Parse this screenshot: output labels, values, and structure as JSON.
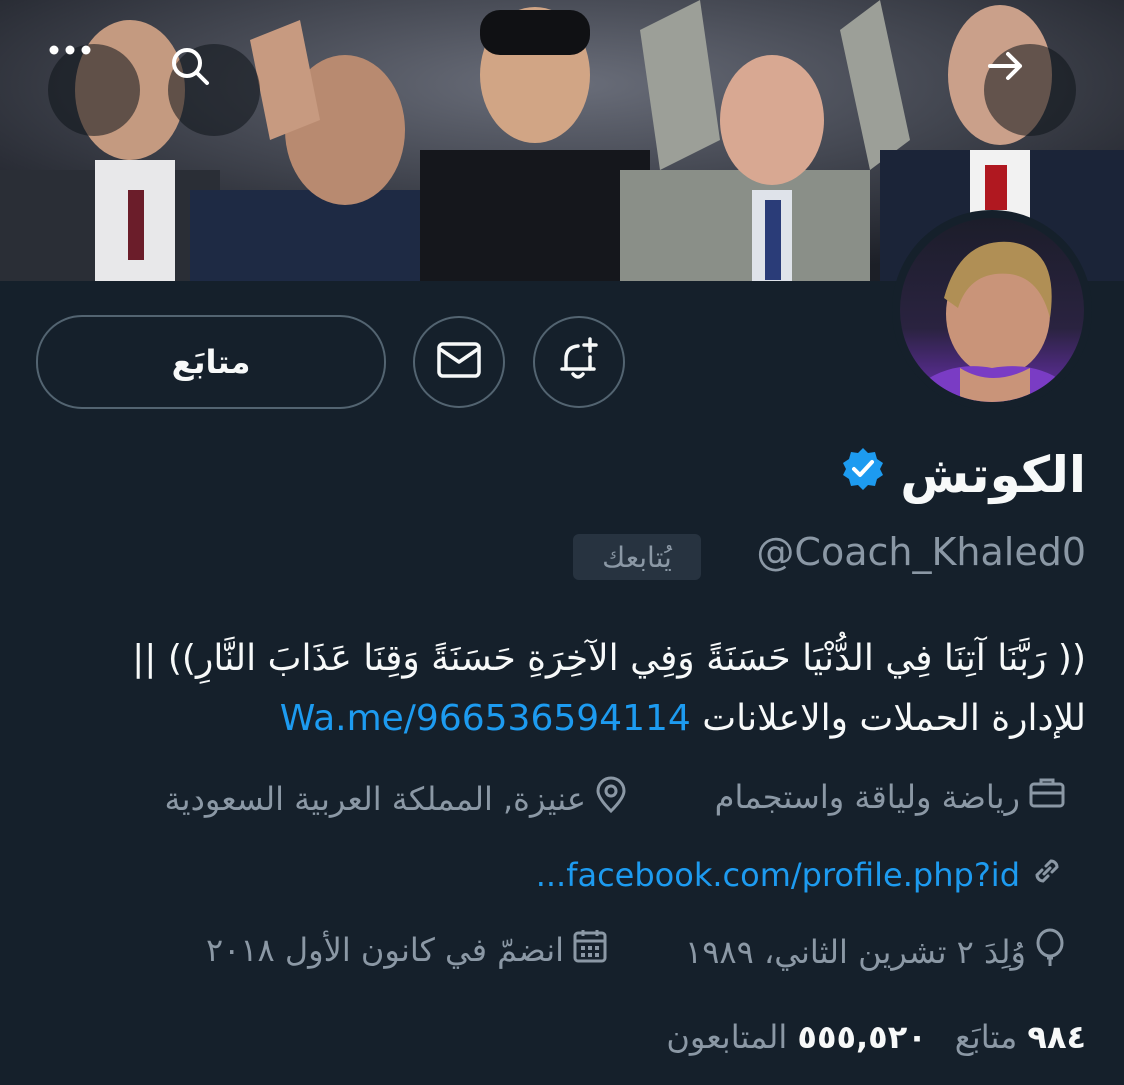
{
  "header": {
    "back_icon": "arrow-right-icon",
    "search_icon": "search-icon",
    "more_icon": "more-icon"
  },
  "actions": {
    "follow_label": "متابَع",
    "message_icon": "envelope-icon",
    "notify_icon": "bell-plus-icon"
  },
  "profile": {
    "name": "الكوتش",
    "verified_icon": "verified-badge-icon",
    "handle": "@Coach_Khaled0",
    "follows_you": "يُتابعك",
    "bio_line1": "(( رَبَّنَا آتِنَا فِي الدُّنْيَا حَسَنَةً وَفِي الآخِرَةِ حَسَنَةً وَقِنَا عَذَابَ النَّارِ)) ||",
    "bio_line2_text": "للإدارة الحملات والاعلانات",
    "bio_link": "Wa.me/966536594114",
    "category": "رياضة ولياقة واستجمام",
    "location": "عنيزة, المملكة العربية السعودية",
    "website": "facebook.com/profile.php?id...",
    "born": "وُلِدَ ٢ تشرين الثاني، ١٩٨٩",
    "joined": "انضمّ في كانون الأول ٢٠١٨"
  },
  "stats": {
    "following_count": "٩٨٤",
    "following_label": "متابَع",
    "followers_count": "٥٥٥,٥٢٠",
    "followers_label": "المتابعون"
  },
  "colors": {
    "background": "#15202b",
    "accent": "#1d9bf0",
    "muted": "#8b98a5"
  }
}
